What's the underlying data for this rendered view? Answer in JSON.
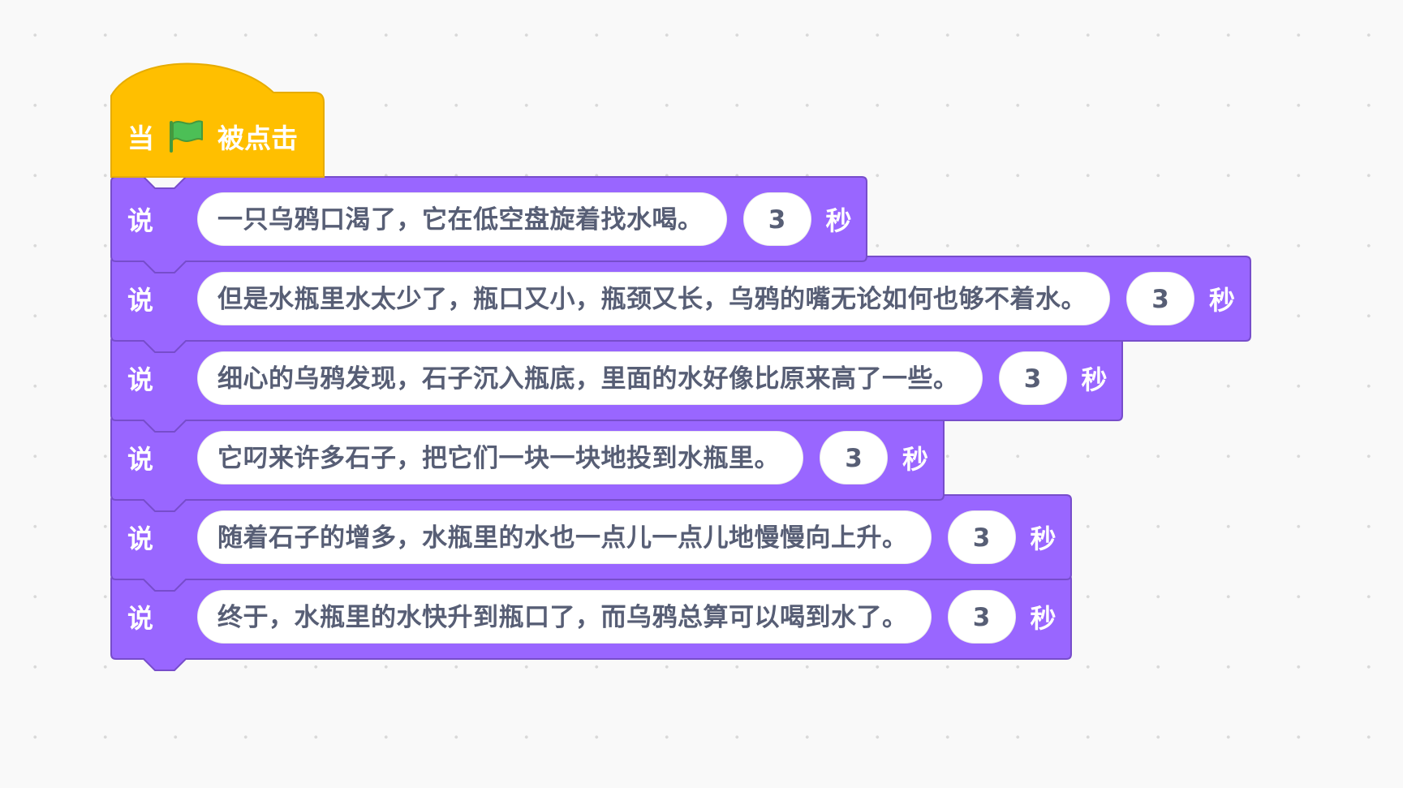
{
  "hat_block": {
    "prefix": "当",
    "flag_icon": "green-flag-icon",
    "suffix": "被点击"
  },
  "colors": {
    "hat": "#FFBF00",
    "hat_border": "#E6AC00",
    "looks": "#9966FF",
    "looks_border": "#774DCB",
    "input_text": "#575E75",
    "flag_green": "#4CBF56"
  },
  "say_blocks": [
    {
      "label": "说",
      "message": "一只乌鸦口渴了，它在低空盘旋着找水喝。",
      "seconds": "3",
      "unit": "秒"
    },
    {
      "label": "说",
      "message": "但是水瓶里水太少了，瓶口又小，瓶颈又长，乌鸦的嘴无论如何也够不着水。",
      "seconds": "3",
      "unit": "秒"
    },
    {
      "label": "说",
      "message": "细心的乌鸦发现，石子沉入瓶底，里面的水好像比原来高了一些。",
      "seconds": "3",
      "unit": "秒"
    },
    {
      "label": "说",
      "message": "它叼来许多石子，把它们一块一块地投到水瓶里。",
      "seconds": "3",
      "unit": "秒"
    },
    {
      "label": "说",
      "message": "随着石子的增多，水瓶里的水也一点儿一点儿地慢慢向上升。",
      "seconds": "3",
      "unit": "秒"
    },
    {
      "label": "说",
      "message": "终于，水瓶里的水快升到瓶口了，而乌鸦总算可以喝到水了。",
      "seconds": "3",
      "unit": "秒"
    }
  ]
}
